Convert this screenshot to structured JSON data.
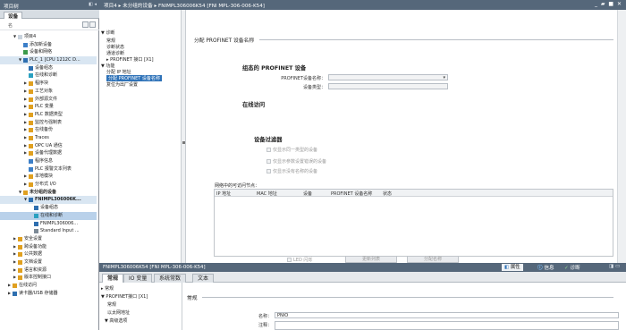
{
  "tree": {
    "title": "项目树",
    "tab": "设备",
    "toolbar_label": "名",
    "items": [
      {
        "label": "项目4",
        "depth": 0,
        "arrow": "▼",
        "icon": "#c8d2dc"
      },
      {
        "label": "添加新设备",
        "depth": 1,
        "arrow": "",
        "icon": "#3c7fc8"
      },
      {
        "label": "设备和网络",
        "depth": 1,
        "arrow": "",
        "icon": "#3c9a4a"
      },
      {
        "label": "PLC_1 [CPU 1212C D...",
        "depth": 1,
        "arrow": "▼",
        "icon": "#2e6fb0",
        "state": "selb"
      },
      {
        "label": "设备组态",
        "depth": 2,
        "arrow": "",
        "icon": "#2e6fb0"
      },
      {
        "label": "在线和诊断",
        "depth": 2,
        "arrow": "",
        "icon": "#2aa0c0"
      },
      {
        "label": "程序块",
        "depth": 2,
        "arrow": "▶",
        "icon": "#e0a020"
      },
      {
        "label": "工艺对象",
        "depth": 2,
        "arrow": "▶",
        "icon": "#e0a020"
      },
      {
        "label": "外部源文件",
        "depth": 2,
        "arrow": "▶",
        "icon": "#e0a020"
      },
      {
        "label": "PLC 变量",
        "depth": 2,
        "arrow": "▶",
        "icon": "#e0a020"
      },
      {
        "label": "PLC 数据类型",
        "depth": 2,
        "arrow": "▶",
        "icon": "#e0a020"
      },
      {
        "label": "监控与强制表",
        "depth": 2,
        "arrow": "▶",
        "icon": "#e0a020"
      },
      {
        "label": "在线备份",
        "depth": 2,
        "arrow": "▶",
        "icon": "#e0a020"
      },
      {
        "label": "Traces",
        "depth": 2,
        "arrow": "▶",
        "icon": "#e0a020"
      },
      {
        "label": "OPC UA 通信",
        "depth": 2,
        "arrow": "▶",
        "icon": "#e0a020"
      },
      {
        "label": "设备代理数据",
        "depth": 2,
        "arrow": "▶",
        "icon": "#e0a020"
      },
      {
        "label": "程序信息",
        "depth": 2,
        "arrow": "",
        "icon": "#3c7fc8"
      },
      {
        "label": "PLC 报警文本列表",
        "depth": 2,
        "arrow": "",
        "icon": "#3c7fc8"
      },
      {
        "label": "本地模块",
        "depth": 2,
        "arrow": "▶",
        "icon": "#e0a020"
      },
      {
        "label": "分布式 I/O",
        "depth": 2,
        "arrow": "▶",
        "icon": "#e0a020"
      },
      {
        "label": "未分组的设备",
        "depth": 1,
        "arrow": "▼",
        "icon": "#e0a020",
        "bold": true
      },
      {
        "label": "FNIMPL306006K...",
        "depth": 2,
        "arrow": "▼",
        "icon": "#2e6fb0",
        "bold": true,
        "state": "selb"
      },
      {
        "label": "设备组态",
        "depth": 3,
        "arrow": "",
        "icon": "#2e6fb0"
      },
      {
        "label": "在线和诊断",
        "depth": 3,
        "arrow": "",
        "icon": "#2aa0c0",
        "state": "sel"
      },
      {
        "label": "FNIMPL306006...",
        "depth": 3,
        "arrow": "",
        "icon": "#2e6fb0"
      },
      {
        "label": "Standard Input ...",
        "depth": 3,
        "arrow": "",
        "icon": "#7d8a96"
      },
      {
        "label": "安全设置",
        "depth": 0,
        "arrow": "▶",
        "icon": "#e0a020"
      },
      {
        "label": "跨设备功能",
        "depth": 0,
        "arrow": "▶",
        "icon": "#e0a020"
      },
      {
        "label": "公共数据",
        "depth": 0,
        "arrow": "▶",
        "icon": "#e0a020"
      },
      {
        "label": "文档设置",
        "depth": 0,
        "arrow": "▶",
        "icon": "#e0a020"
      },
      {
        "label": "语言和资源",
        "depth": 0,
        "arrow": "▶",
        "icon": "#e0a020"
      },
      {
        "label": "版本控制接口",
        "depth": 0,
        "arrow": "▶",
        "icon": "#e0a020"
      },
      {
        "label": "在线访问",
        "depth": -1,
        "arrow": "▶",
        "icon": "#e0a020"
      },
      {
        "label": "读卡器/USB 存储器",
        "depth": -1,
        "arrow": "▶",
        "icon": "#2e6fb0"
      }
    ]
  },
  "main": {
    "breadcrumb": "项目4 ▸ 未分组的设备 ▸ FNIMPL306006K54 [FNI MPL-306-006-K54]",
    "window_controls": "_ ▰ ■ ✕",
    "nav": [
      {
        "label": "▼ 诊断",
        "x": 2,
        "y": 22
      },
      {
        "label": "常规",
        "x": 8,
        "y": 31
      },
      {
        "label": "诊断状态",
        "x": 8,
        "y": 38
      },
      {
        "label": "通道诊断",
        "x": 8,
        "y": 45
      },
      {
        "label": "▸ PROFINET 接口 [X1]",
        "x": 8,
        "y": 52
      },
      {
        "label": "▼ 功能",
        "x": 2,
        "y": 59
      },
      {
        "label": "分配 IP 地址",
        "x": 8,
        "y": 66
      },
      {
        "label": "分配 PROFINET 设备名称",
        "x": 8,
        "y": 73,
        "sel": true
      },
      {
        "label": "复位为出厂设置",
        "x": 8,
        "y": 80
      }
    ],
    "section_title": "分配 PROFINET 设备名称",
    "configured_title": "组态的 PROFINET 设备",
    "device_name_label": "PROFINET设备名称：",
    "device_type_label": "设备类型：",
    "online_access_title": "在线访问",
    "filter_title": "设备过滤器",
    "filter_options": [
      "仅显示同一类型的设备",
      "仅显示参数设置错误的设备",
      "仅显示没有名称的设备"
    ],
    "accessible_nodes_label": "网络中的可访问节点：",
    "table_columns": [
      "IP 地址",
      "MAC 地址",
      "设备",
      "PROFINET 设备名称",
      "状态"
    ],
    "led_flash": "LED 闪烁",
    "btn_update_list": "更新列表",
    "btn_assign_name": "分配名称"
  },
  "props": {
    "title": "FNIMPL306006K54 [FNI MPL-306-006-K54]",
    "right_tabs": {
      "properties": "属性",
      "info": "信息",
      "diagnostics": "诊断"
    },
    "tabs": [
      "常规",
      "IO 变量",
      "系统常数",
      "文本"
    ],
    "nav": [
      "▸ 常规",
      "▼ PROFINET接口 [X1]",
      "常规",
      "以太网地址",
      "▼ 高级选项"
    ],
    "section": "常规",
    "name_label": "名称：",
    "name_value": "PNIO",
    "comment_label": "注释："
  }
}
